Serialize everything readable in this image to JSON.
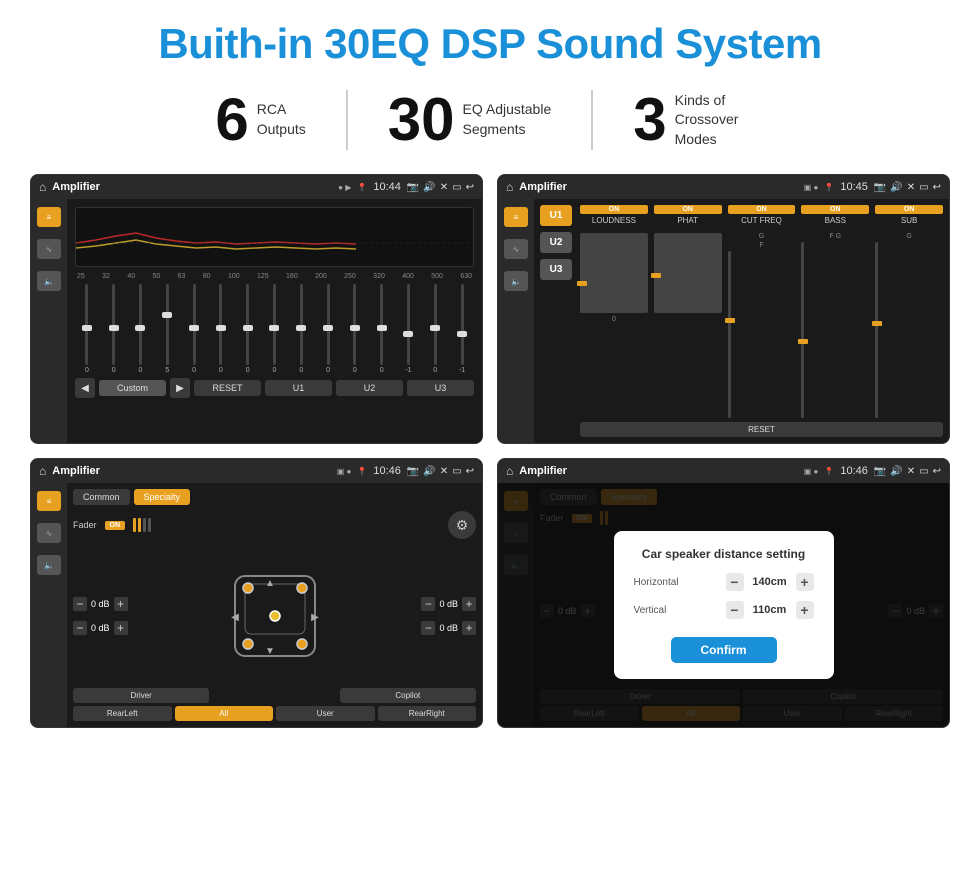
{
  "title": "Buith-in 30EQ DSP Sound System",
  "stats": [
    {
      "number": "6",
      "desc": "RCA\nOutputs"
    },
    {
      "number": "30",
      "desc": "EQ Adjustable\nSegments"
    },
    {
      "number": "3",
      "desc": "Kinds of\nCrossover Modes"
    }
  ],
  "screens": [
    {
      "id": "eq-screen",
      "statusBar": {
        "title": "Amplifier",
        "time": "10:44"
      },
      "type": "eq"
    },
    {
      "id": "dsp-screen",
      "statusBar": {
        "title": "Amplifier",
        "time": "10:45"
      },
      "type": "dsp"
    },
    {
      "id": "crossover-screen",
      "statusBar": {
        "title": "Amplifier",
        "time": "10:46"
      },
      "type": "crossover"
    },
    {
      "id": "distance-screen",
      "statusBar": {
        "title": "Amplifier",
        "time": "10:46"
      },
      "type": "distance"
    }
  ],
  "eq": {
    "freqs": [
      "25",
      "32",
      "40",
      "50",
      "63",
      "80",
      "100",
      "125",
      "160",
      "200",
      "250",
      "320",
      "400",
      "500",
      "630"
    ],
    "values": [
      "0",
      "0",
      "0",
      "5",
      "0",
      "0",
      "0",
      "0",
      "0",
      "0",
      "0",
      "0",
      "-1",
      "0",
      "-1"
    ],
    "controls": [
      "Custom",
      "RESET",
      "U1",
      "U2",
      "U3"
    ]
  },
  "dsp": {
    "presets": [
      "U1",
      "U2",
      "U3"
    ],
    "channels": [
      "LOUDNESS",
      "PHAT",
      "CUT FREQ",
      "BASS",
      "SUB"
    ],
    "resetLabel": "RESET"
  },
  "crossover": {
    "tabs": [
      "Common",
      "Specialty"
    ],
    "faderLabel": "Fader",
    "onLabel": "ON",
    "bottomBtns": [
      "Driver",
      "",
      "Copilot",
      "RearLeft",
      "All",
      "User",
      "RearRight"
    ]
  },
  "distance": {
    "dialogTitle": "Car speaker distance setting",
    "horizontalLabel": "Horizontal",
    "horizontalValue": "140cm",
    "verticalLabel": "Vertical",
    "verticalValue": "110cm",
    "confirmLabel": "Confirm"
  }
}
